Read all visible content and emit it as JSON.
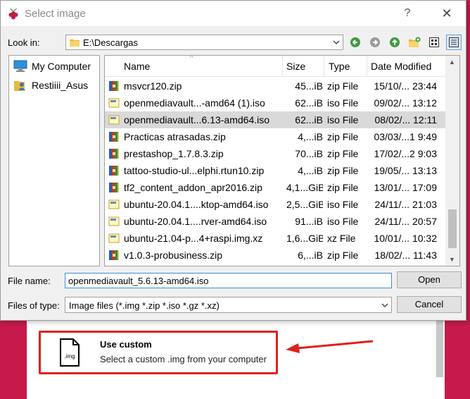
{
  "dialog": {
    "title": "Select image",
    "help": "?",
    "close": "✕"
  },
  "toolbar": {
    "look_in_label": "Look in:",
    "look_in_value": "E:\\Descargas"
  },
  "sidebar": {
    "items": [
      {
        "label": "My Computer",
        "icon": "computer-icon"
      },
      {
        "label": "Restiiii_Asus",
        "icon": "user-folder-icon"
      }
    ]
  },
  "list": {
    "headers": {
      "name": "Name",
      "size": "Size",
      "type": "Type",
      "date": "Date Modified"
    },
    "rows": [
      {
        "name": "msvcr120.zip",
        "size": "45...iB",
        "type": "zip File",
        "date": "15/10/... 23:44",
        "icon": "zip-icon"
      },
      {
        "name": "openmediavault...-amd64 (1).iso",
        "size": "62...iB",
        "type": "iso File",
        "date": "09/02/... 13:12",
        "icon": "iso-icon"
      },
      {
        "name": "openmediavault...6.13-amd64.iso",
        "size": "62...iB",
        "type": "iso File",
        "date": "08/02/... 12:11",
        "icon": "iso-icon",
        "selected": true
      },
      {
        "name": "Practicas atrasadas.zip",
        "size": "4,...iB",
        "type": "zip File",
        "date": "03/03/...1 9:49",
        "icon": "zip-icon"
      },
      {
        "name": "prestashop_1.7.8.3.zip",
        "size": "70...iB",
        "type": "zip File",
        "date": "17/02/...2 9:03",
        "icon": "zip-icon"
      },
      {
        "name": "tattoo-studio-ul...elphi.rtun10.zip",
        "size": "4,...iB",
        "type": "zip File",
        "date": "19/05/... 13:13",
        "icon": "zip-icon"
      },
      {
        "name": "tf2_content_addon_apr2016.zip",
        "size": "4,1...GiB",
        "type": "zip File",
        "date": "13/01/... 17:09",
        "icon": "zip-icon"
      },
      {
        "name": "ubuntu-20.04.1....ktop-amd64.iso",
        "size": "2,5...GiB",
        "type": "iso File",
        "date": "24/11/... 21:03",
        "icon": "iso-icon"
      },
      {
        "name": "ubuntu-20.04.1....rver-amd64.iso",
        "size": "91...iB",
        "type": "iso File",
        "date": "24/11/... 20:57",
        "icon": "iso-icon"
      },
      {
        "name": "ubuntu-21.04-p...4+raspi.img.xz",
        "size": "1,6...GiB",
        "type": "xz File",
        "date": "10/01/... 10:32",
        "icon": "xz-icon"
      },
      {
        "name": "v1.0.3-probusiness.zip",
        "size": "6,...iB",
        "type": "zip File",
        "date": "18/02/... 11:43",
        "icon": "zip-icon"
      }
    ]
  },
  "footer": {
    "file_name_label": "File name:",
    "file_name_value": "openmediavault_5.6.13-amd64.iso",
    "file_type_label": "Files of type:",
    "file_type_value": "Image files (*.img *.zip *.iso *.gz *.xz)",
    "open_label": "Open",
    "cancel_label": "Cancel"
  },
  "background": {
    "custom_title": "Use custom",
    "custom_subtitle": "Select a custom .img from your computer",
    "custom_icon_text": ".img",
    "accent": "#c51a4a",
    "annotation_color": "#e0201c"
  }
}
